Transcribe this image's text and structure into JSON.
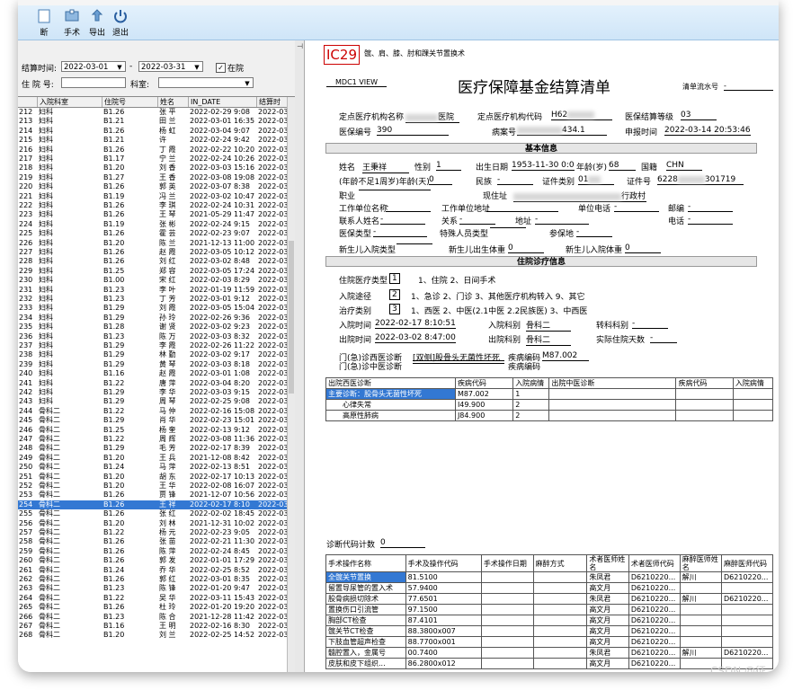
{
  "toolbar": {
    "buttons": [
      "断",
      "手术",
      "导出",
      "退出"
    ]
  },
  "filters": {
    "date_label": "结算时间:",
    "date_from": "2022-03-01",
    "date_sep": "-",
    "date_to": "2022-03-31",
    "in_hospital_label": "在院",
    "in_hospital_checked": "✓",
    "inpatient_no_label": "住 院 号:",
    "dept_label": "科室:"
  },
  "grid": {
    "headers": [
      "",
      "入院科室",
      "住院号",
      "姓名",
      "IN_DATE",
      "结算时"
    ],
    "rows": [
      [
        "212",
        "妇科",
        "B1.26",
        "张 平",
        "2022-02-29 9:08",
        "2022-03"
      ],
      [
        "213",
        "妇科",
        "B1.21",
        "田 兰",
        "2022-03-01 16:35",
        "2022-03"
      ],
      [
        "214",
        "妇科",
        "B1.26",
        "杨 虹",
        "2022-03-04 9:07",
        "2022-03"
      ],
      [
        "215",
        "妇科",
        "B1.21",
        "许",
        "2022-02-24 9:42",
        "2022-03"
      ],
      [
        "216",
        "妇科",
        "B1.26",
        "丁 霞",
        "2022-02-22 10:20",
        "2022-03"
      ],
      [
        "217",
        "妇科",
        "B1.17",
        "宁 兰",
        "2022-02-24 10:26",
        "2022-03"
      ],
      [
        "218",
        "妇科",
        "B1.20",
        "刘 香",
        "2022-03-03 15:16",
        "2022-03"
      ],
      [
        "219",
        "妇科",
        "B1.27",
        "王 香",
        "2022-03-08 19:08",
        "2022-03"
      ],
      [
        "220",
        "妇科",
        "B1.26",
        "郭 英",
        "2022-03-07 8:38",
        "2022-03"
      ],
      [
        "221",
        "妇科",
        "B1.19",
        "冯 兰",
        "2022-03-02 10:47",
        "2022-03"
      ],
      [
        "222",
        "妇科",
        "B1.26",
        "李 琪",
        "2022-02-24 10:31",
        "2022-03"
      ],
      [
        "223",
        "妇科",
        "B1.26",
        "王 琴",
        "2021-05-29 11:47",
        "2022-03"
      ],
      [
        "224",
        "妇科",
        "B1.19",
        "张 彬",
        "2022-02-24 9:15",
        "2022-03"
      ],
      [
        "225",
        "妇科",
        "B1.26",
        "霍 芸",
        "2022-02-23 9:07",
        "2022-03"
      ],
      [
        "226",
        "妇科",
        "B1.20",
        "陈 兰",
        "2021-12-13 11:00",
        "2022-03"
      ],
      [
        "227",
        "妇科",
        "B1.26",
        "赵 霞",
        "2022-03-05 10:12",
        "2022-03"
      ],
      [
        "228",
        "妇科",
        "B1.26",
        "刘 红",
        "2022-03-02 8:48",
        "2022-03"
      ],
      [
        "229",
        "妇科",
        "B1.25",
        "郑 容",
        "2022-03-05 17:24",
        "2022-03"
      ],
      [
        "230",
        "妇科",
        "B1.00",
        "宋 红",
        "2022-02-03 8:29",
        "2022-03"
      ],
      [
        "231",
        "妇科",
        "B1.23",
        "李 叶",
        "2022-01-19 11:59",
        "2022-03"
      ],
      [
        "232",
        "妇科",
        "B1.23",
        "丁 芳",
        "2022-03-01 9:12",
        "2022-03"
      ],
      [
        "233",
        "妇科",
        "B1.29",
        "刘 霞",
        "2022-03-05 15:04",
        "2022-03"
      ],
      [
        "234",
        "妇科",
        "B1.29",
        "孙 玲",
        "2022-02-26 9:36",
        "2022-03"
      ],
      [
        "235",
        "妇科",
        "B1.28",
        "谢 贤",
        "2022-03-02 9:23",
        "2022-03"
      ],
      [
        "236",
        "妇科",
        "B1.23",
        "陈 万",
        "2022-03-03 8:32",
        "2022-03"
      ],
      [
        "237",
        "妇科",
        "B1.29",
        "李 霞",
        "2022-02-26 11:22",
        "2022-03"
      ],
      [
        "238",
        "妇科",
        "B1.29",
        "林 勤",
        "2022-03-02 9:17",
        "2022-03"
      ],
      [
        "239",
        "妇科",
        "B1.29",
        "黄 琴",
        "2022-03-03 8:18",
        "2022-03"
      ],
      [
        "240",
        "妇科",
        "B1.16",
        "赵 霞",
        "2022-03-01 1:08",
        "2022-03"
      ],
      [
        "241",
        "妇科",
        "B1.22",
        "唐 萍",
        "2022-03-04 8:20",
        "2022-03"
      ],
      [
        "242",
        "妇科",
        "B1.29",
        "李 华",
        "2022-03-03 9:15",
        "2022-03"
      ],
      [
        "243",
        "妇科",
        "B1.29",
        "周 琴",
        "2022-02-25 9:08",
        "2022-03"
      ],
      [
        "244",
        "骨科二",
        "B1.22",
        "马 仲",
        "2022-02-16 15:08",
        "2022-03"
      ],
      [
        "245",
        "骨科二",
        "B1.29",
        "肖 华",
        "2022-02-23 15:01",
        "2022-03"
      ],
      [
        "246",
        "骨科二",
        "B1.25",
        "杨 奎",
        "2022-02-13 9:12",
        "2022-03"
      ],
      [
        "247",
        "骨科二",
        "B1.22",
        "周 辉",
        "2022-03-08 11:36",
        "2022-03"
      ],
      [
        "248",
        "骨科二",
        "B1.29",
        "毛 芳",
        "2022-02-17 8:39",
        "2022-03"
      ],
      [
        "249",
        "骨科二",
        "B1.20",
        "王 兵",
        "2021-12-08 8:42",
        "2022-03"
      ],
      [
        "250",
        "骨科二",
        "B1.24",
        "马 萍",
        "2022-02-13 8:51",
        "2022-03"
      ],
      [
        "251",
        "骨科二",
        "B1.20",
        "胡 东",
        "2022-02-17 10:13",
        "2022-03"
      ],
      [
        "252",
        "骨科二",
        "B1.20",
        "王 华",
        "2022-02-08 16:07",
        "2022-03"
      ],
      [
        "253",
        "骨科二",
        "B1.26",
        "贾 锋",
        "2021-12-07 10:56",
        "2022-03"
      ],
      [
        "254",
        "骨科二",
        "B1.26",
        "王 祥",
        "2022-02-17 8:10",
        "2022-03"
      ],
      [
        "255",
        "骨科二",
        "B1.26",
        "张 红",
        "2022-02-02 18:45",
        "2022-03"
      ],
      [
        "256",
        "骨科二",
        "B1.20",
        "刘 林",
        "2021-12-31 10:02",
        "2022-03"
      ],
      [
        "257",
        "骨科二",
        "B1.22",
        "杨 元",
        "2022-02-23 9:05",
        "2022-03"
      ],
      [
        "258",
        "骨科二",
        "B1.26",
        "张 苗",
        "2022-02-21 11:30",
        "2022-03"
      ],
      [
        "259",
        "骨科二",
        "B1.26",
        "陈 萍",
        "2022-02-24 8:45",
        "2022-03"
      ],
      [
        "260",
        "骨科二",
        "B1.26",
        "郭 发",
        "2022-01-01 17:29",
        "2022-03"
      ],
      [
        "261",
        "骨科二",
        "B1.24",
        "乔 华",
        "2022-02-25 8:52",
        "2022-03"
      ],
      [
        "262",
        "骨科二",
        "B1.26",
        "郭 红",
        "2022-03-01 8:35",
        "2022-03"
      ],
      [
        "263",
        "骨科二",
        "B1.23",
        "陈 锋",
        "2022-01-20 9:47",
        "2022-03"
      ],
      [
        "264",
        "骨科二",
        "B1.22",
        "吴 华",
        "2022-03-11 15:43",
        "2022-03"
      ],
      [
        "265",
        "骨科二",
        "B1.26",
        "杜 玲",
        "2022-01-20 19:20",
        "2022-03"
      ],
      [
        "266",
        "骨科二",
        "B1.23",
        "陈 合",
        "2021-12-28 11:42",
        "2022-03"
      ],
      [
        "267",
        "骨科二",
        "B1.16",
        "王 明",
        "2022-02-16 8:30",
        "2022-03"
      ],
      [
        "268",
        "骨科二",
        "B1.20",
        "刘 兰",
        "2022-02-25 14:52",
        "2022-03"
      ]
    ],
    "selected_row_number": "254"
  },
  "report": {
    "form_code": "IC29",
    "form_desc": "髋、肩、膝、肘和踝关节置换术",
    "mdc_view": "MDC1 VIEW",
    "title": "医疗保障基金结算清单",
    "list_no_label": "清单流水号",
    "list_no_value": "-",
    "fixed_inst_label": "定点医疗机构名称",
    "fixed_inst_value": "医院",
    "inst_code_label": "定点医疗机构代码",
    "inst_code_value": "H62",
    "settle_level_label": "医保结算等级",
    "settle_level_value": "03",
    "ins_no_label": "医保编号",
    "ins_no_value": "390",
    "case_no_label": "病案号",
    "case_no_value": "434.1",
    "apply_time_label": "申报时间",
    "apply_time_value": "2022-03-14 20:53:46",
    "basic_head": "基本信息",
    "name_label": "姓名",
    "name_value": "王秉祥",
    "gender_label": "性别",
    "gender_value": "1",
    "birth_label": "出生日期",
    "birth_value": "1953-11-30 0:0",
    "age_label": "年龄(岁)",
    "age_value": "68",
    "nation_label": "国籍",
    "nation_value": "CHN",
    "infant_age_label": "(年龄不足1周岁)年龄(天)",
    "infant_age_value": "0",
    "ethnic_label": "民族",
    "ethnic_value": "-",
    "id_type_label": "证件类别",
    "id_type_value": "01",
    "id_no_label": "证件号",
    "id_no_value": "6228",
    "id_no_tail": "301719",
    "job_label": "职业",
    "job_value": "",
    "addr_label": "现住址",
    "addr_value": "行政村",
    "work_label": "工作单位名称",
    "work_value": "-",
    "work_addr_label": "工作单位地址",
    "work_addr_value": "-",
    "work_tel_label": "单位电话",
    "work_tel_value": "-",
    "zip_label": "邮编",
    "zip_value": "-",
    "contact_label": "联系人姓名",
    "contact_value": "-",
    "relation_label": "关系",
    "relation_value": "-",
    "contact_addr_label": "地址",
    "contact_addr_value": "-",
    "tel_label": "电话",
    "tel_value": "-",
    "ins_type_label": "医保类型",
    "ins_type_value": "-",
    "special_label": "特殊人员类型",
    "special_value": "",
    "insured_place_label": "参保地",
    "insured_place_value": "-",
    "nb_type_label": "新生儿入院类型",
    "nb_weight_label": "新生儿出生体重",
    "nb_weight_value": "0",
    "nb_in_weight_label": "新生儿入院体重",
    "nb_in_weight_value": "0",
    "diag_head": "住院诊疗信息",
    "stay_type_label": "住院医疗类型",
    "stay_type_value": "1",
    "stay_type_opts": "1、住院    2、日间手术",
    "adm_route_label": "入院途径",
    "adm_route_value": "2",
    "adm_route_opts": "1、急诊  2、门诊  3、其他医疗机构转入  9、其它",
    "treat_label": "治疗类别",
    "treat_value": "3",
    "treat_opts": "1、西医  2、中医(2.1中医  2.2民族医)  3、中西医",
    "adm_time_label": "入院时间",
    "adm_time_value": "2022-02-17 8:10:51",
    "adm_dept_label": "入院科别",
    "adm_dept_value": "骨科二",
    "transfer_label": "转科科别",
    "transfer_value": "-",
    "dis_time_label": "出院时间",
    "dis_time_value": "2022-03-02 8:47:00",
    "dis_dept_label": "出院科别",
    "dis_dept_value": "骨科二",
    "actual_days_label": "实际住院天数",
    "actual_days_value": "-",
    "opd_wm_label": "门(急)诊西医诊断",
    "opd_wm_value": "[双侧]股骨头无菌性坏死",
    "dis_code_label": "疾病编码",
    "dis_code_value": "M87.002",
    "opd_tcm_label": "门(急)诊中医诊断",
    "opd_tcm_value": "",
    "dis_code2_label": "疾病编码",
    "dis_code2_value": ""
  },
  "diag_table": {
    "headers": [
      "出院西医诊断",
      "疾病代码",
      "入院病情",
      "出院中医诊断",
      "疾病代码",
      "入院病情"
    ],
    "rows": [
      [
        "主要诊断：股骨头无菌性坏死",
        "M87.002",
        "1",
        "",
        "",
        ""
      ],
      [
        "心律失常",
        "I49.900",
        "2",
        "",
        "",
        ""
      ],
      [
        "高原性肺病",
        "J84.900",
        "2",
        "",
        "",
        ""
      ]
    ]
  },
  "diag_count_label": "诊断代码计数",
  "diag_count_value": "0",
  "op_table": {
    "headers": [
      "手术操作名称",
      "手术及操作代码",
      "手术操作日期",
      "麻醉方式",
      "术者医师姓名",
      "术者医师代码",
      "麻醉医师姓名",
      "麻醉医师代码"
    ],
    "rows": [
      [
        "全髋关节置换",
        "81.5100",
        "",
        "",
        "朱凤君",
        "D6210220...",
        "解川",
        "D6210220..."
      ],
      [
        "留置导尿管的置入术",
        "57.9400",
        "",
        "",
        "高文月",
        "D6210220...",
        "",
        ""
      ],
      [
        "股骨病损切除术",
        "77.6501",
        "",
        "",
        "朱凤君",
        "D6210220...",
        "解川",
        "D6210220..."
      ],
      [
        "置换伤口引流管",
        "97.1500",
        "",
        "",
        "高文月",
        "D6210220...",
        "",
        ""
      ],
      [
        "胸部CT检查",
        "87.4101",
        "",
        "",
        "高文月",
        "D6210220...",
        "",
        ""
      ],
      [
        "髋关节CT检查",
        "88.3800x007",
        "",
        "",
        "高文月",
        "D6210220...",
        "",
        ""
      ],
      [
        "下肢血管超声检查",
        "88.7700x001",
        "",
        "",
        "高文月",
        "D6210220...",
        "",
        ""
      ],
      [
        "髓腔置入，金属号",
        "00.7400",
        "",
        "",
        "朱凤君",
        "D6210220...",
        "解川",
        "D6210220..."
      ],
      [
        "皮肤和皮下组织...",
        "86.2800x012",
        "",
        "",
        "高文月",
        "D6210220...",
        "",
        ""
      ]
    ]
  },
  "watermark": "CSDN @征",
  "colors": {
    "selection": "#3378d3",
    "toolbar": "#d7eaf9",
    "accent_red": "#cc0000"
  }
}
